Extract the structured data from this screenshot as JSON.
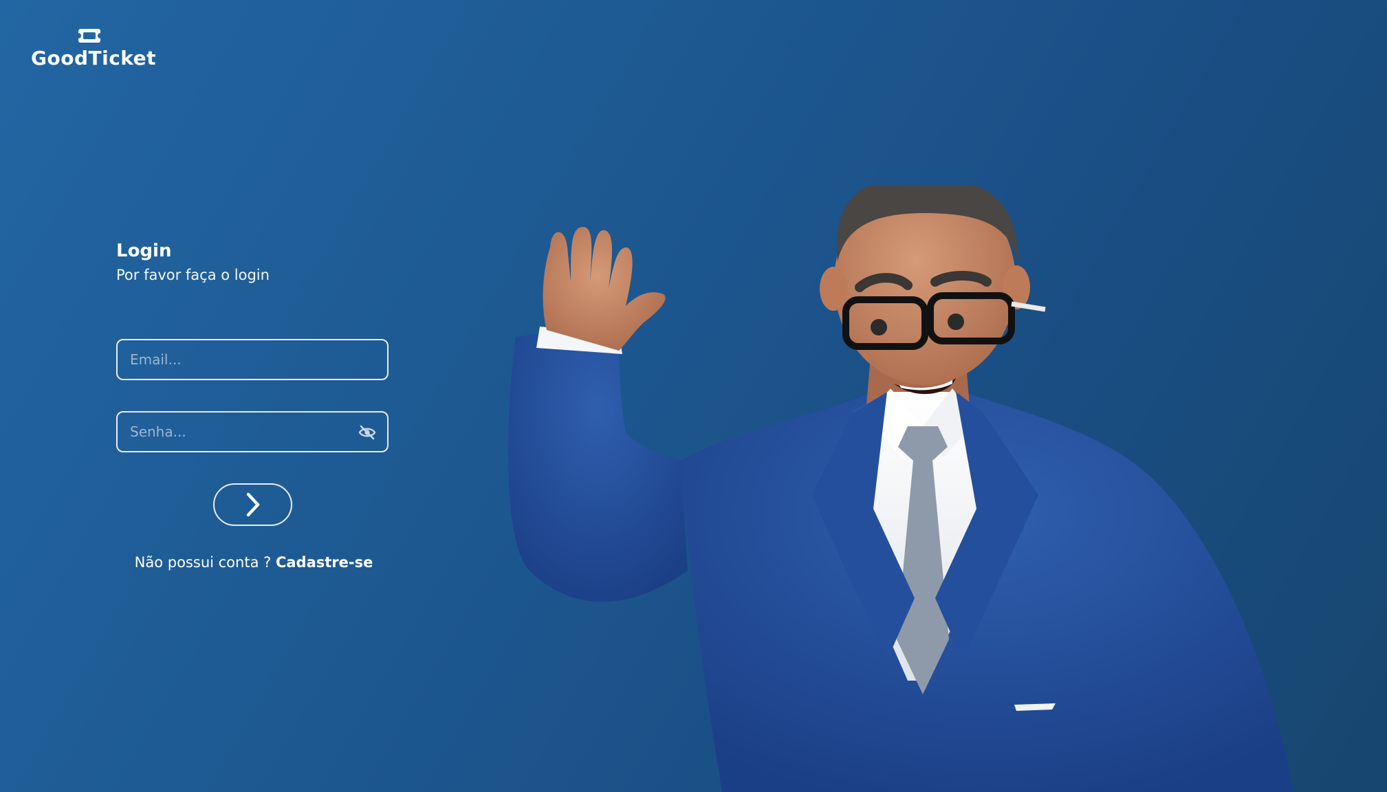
{
  "brand": {
    "name": "GoodTicket",
    "icon": "ticket-icon"
  },
  "login": {
    "title": "Login",
    "subtitle": "Por favor faça o login",
    "email_placeholder": "Email...",
    "email_value": "",
    "password_placeholder": "Senha...",
    "password_value": "",
    "password_toggle_icon": "eye-off-icon",
    "submit_icon": "chevron-right-icon"
  },
  "signup": {
    "prompt": "Não possui conta ?",
    "link": "Cadastre-se"
  },
  "illustration": {
    "subject": "3d-businessman-waving"
  },
  "colors": {
    "background": "#1f5a96",
    "text": "#ffffff",
    "border": "#e8eef6"
  }
}
